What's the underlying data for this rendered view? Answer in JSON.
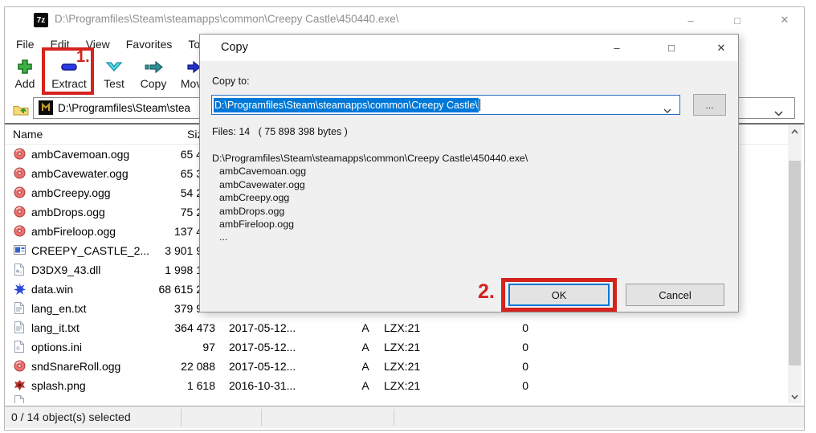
{
  "window": {
    "app_badge": "7z",
    "title": "D:\\Programfiles\\Steam\\steamapps\\common\\Creepy Castle\\450440.exe\\",
    "minimize_glyph": "–",
    "maximize_glyph": "□",
    "close_glyph": "✕"
  },
  "menu": {
    "items": [
      "File",
      "Edit",
      "View",
      "Favorites",
      "Tools"
    ]
  },
  "toolbar": {
    "buttons": [
      {
        "label": "Add"
      },
      {
        "label": "Extract"
      },
      {
        "label": "Test"
      },
      {
        "label": "Copy"
      },
      {
        "label": "Move"
      }
    ]
  },
  "address_bar": {
    "path": "D:\\Programfiles\\Steam\\stea"
  },
  "file_list": {
    "headers": {
      "name": "Name",
      "size": "Size"
    },
    "rows": [
      {
        "icon": "audio-file-icon",
        "name": "ambCavemoan.ogg",
        "size": "65 4"
      },
      {
        "icon": "audio-file-icon",
        "name": "ambCavewater.ogg",
        "size": "65 3"
      },
      {
        "icon": "audio-file-icon",
        "name": "ambCreepy.ogg",
        "size": "54 2"
      },
      {
        "icon": "audio-file-icon",
        "name": "ambDrops.ogg",
        "size": "75 2"
      },
      {
        "icon": "audio-file-icon",
        "name": "ambFireloop.ogg",
        "size": "137 4"
      },
      {
        "icon": "app-file-icon",
        "name": "CREEPY_CASTLE_2...",
        "size": "3 901 9"
      },
      {
        "icon": "dll-file-icon",
        "name": "D3DX9_43.dll",
        "size": "1 998 1"
      },
      {
        "icon": "data-file-icon",
        "name": "data.win",
        "size": "68 615 2"
      },
      {
        "icon": "text-file-icon",
        "name": "lang_en.txt",
        "size": "379 9"
      },
      {
        "icon": "text-file-icon",
        "name": "lang_it.txt",
        "size": "364 473",
        "date": "2017-05-12...",
        "attributes": "A",
        "method": "LZX:21",
        "folders": "0"
      },
      {
        "icon": "ini-file-icon",
        "name": "options.ini",
        "size": "97",
        "date": "2017-05-12...",
        "attributes": "A",
        "method": "LZX:21",
        "folders": "0"
      },
      {
        "icon": "audio-file-icon",
        "name": "sndSnareRoll.ogg",
        "size": "22 088",
        "date": "2017-05-12...",
        "attributes": "A",
        "method": "LZX:21",
        "folders": "0"
      },
      {
        "icon": "image-file-icon",
        "name": "splash.png",
        "size": "1 618",
        "date": "2016-10-31...",
        "attributes": "A",
        "method": "LZX:21",
        "folders": "0"
      }
    ]
  },
  "status_bar": {
    "selection_text": "0 / 14 object(s) selected"
  },
  "dialog": {
    "title": "Copy",
    "minimize_glyph": "–",
    "maximize_glyph": "□",
    "close_glyph": "✕",
    "copy_to_label": "Copy to:",
    "destination_path": "D:\\Programfiles\\Steam\\steamapps\\common\\Creepy Castle\\",
    "browse_label": "...",
    "files_summary": "Files: 14   ( 75 898 398 bytes )",
    "file_list": [
      "D:\\Programfiles\\Steam\\steamapps\\common\\Creepy Castle\\450440.exe\\",
      "ambCavemoan.ogg",
      "ambCavewater.ogg",
      "ambCreepy.ogg",
      "ambDrops.ogg",
      "ambFireloop.ogg",
      "..."
    ],
    "ok_label": "OK",
    "cancel_label": "Cancel"
  },
  "annotations": {
    "step1_label": "1.",
    "step2_label": "2.",
    "red": "#d5231e",
    "selection_blue": "#0078d7"
  }
}
